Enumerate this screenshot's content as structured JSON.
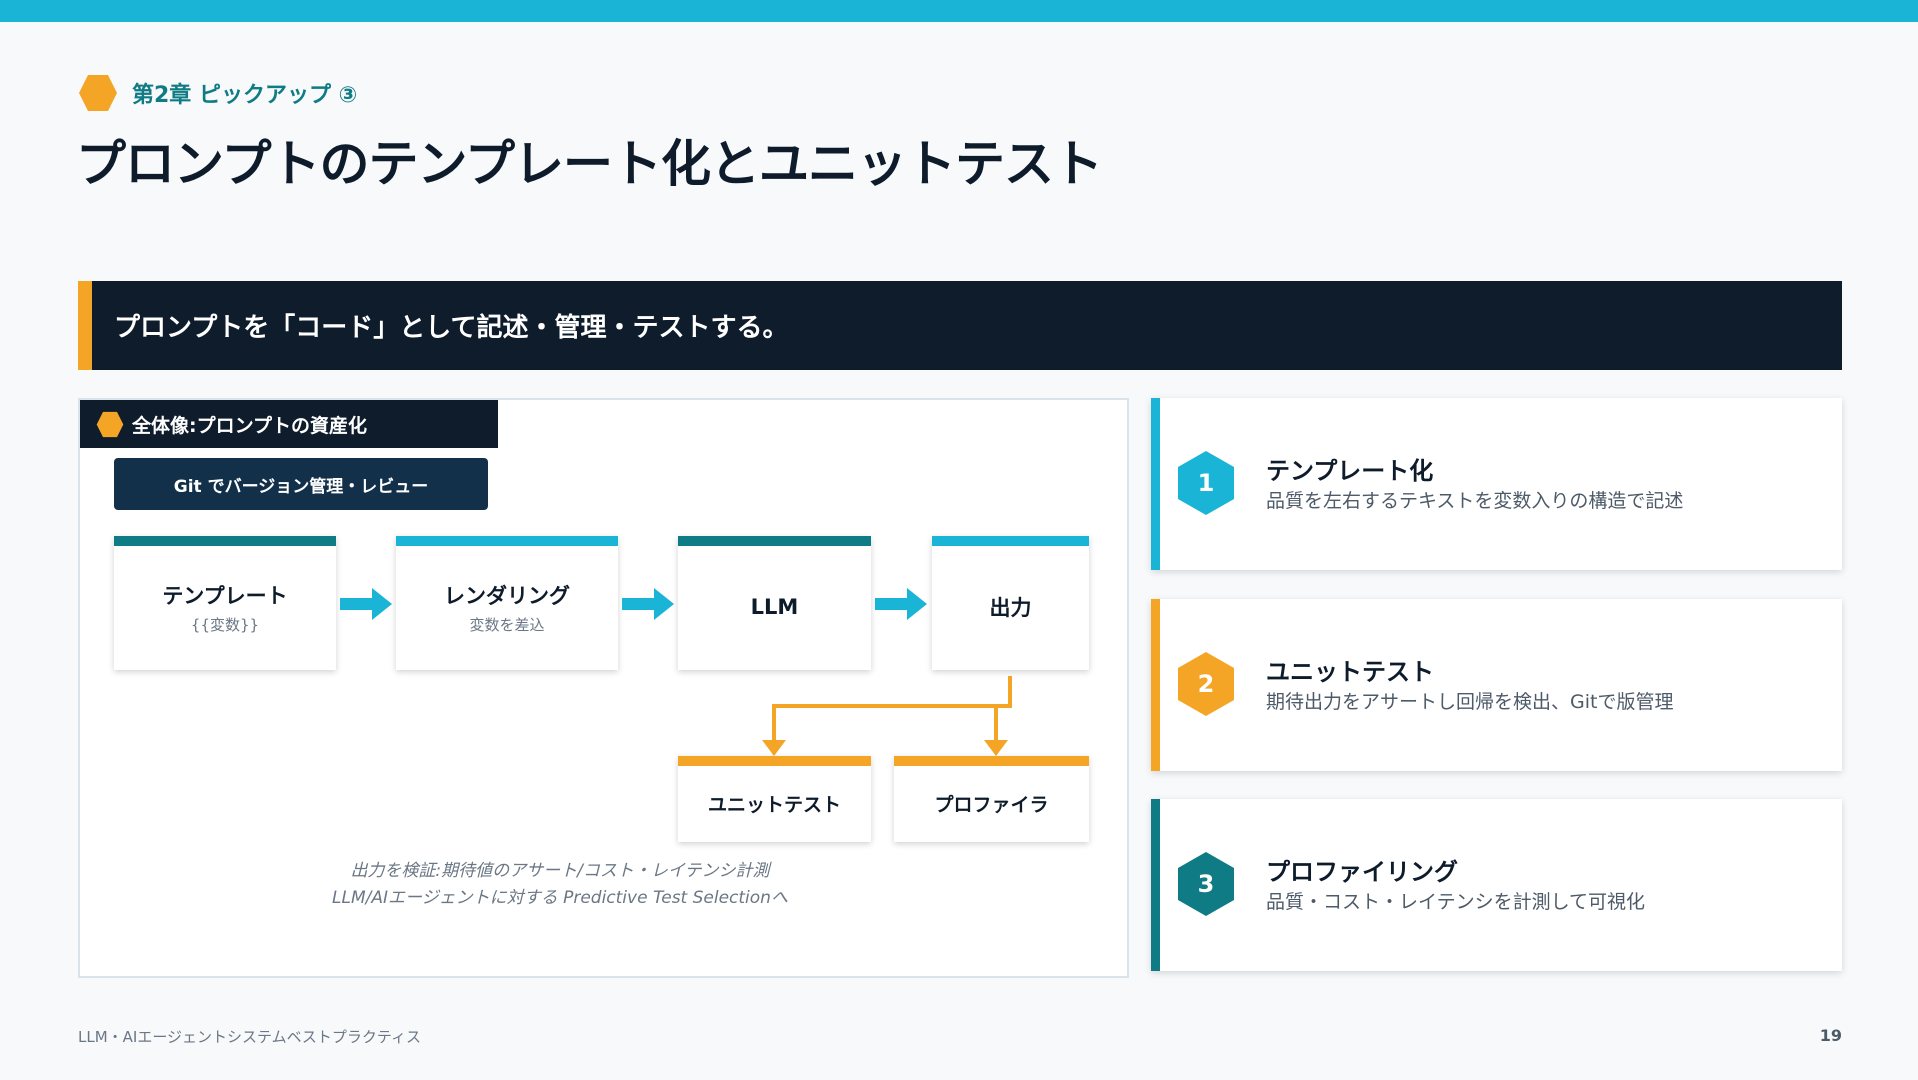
{
  "chapter": {
    "label": "第2章 ピックアップ ③"
  },
  "title": "プロンプトのテンプレート化とユニットテスト",
  "banner": {
    "text": "プロンプトを「コード」として記述・管理・テストする。"
  },
  "diagram": {
    "tab": "全体像:プロンプトの資産化",
    "git": "Git でバージョン管理・レビュー",
    "nodes": {
      "template": {
        "label": "テンプレート",
        "sub": "{{変数}}"
      },
      "rendering": {
        "label": "レンダリング",
        "sub": "変数を差込"
      },
      "llm": {
        "label": "LLM"
      },
      "output": {
        "label": "出力"
      },
      "unittest": {
        "label": "ユニットテスト"
      },
      "profiler": {
        "label": "プロファイラ"
      }
    },
    "caption_line1": "出力を検証:期待値のアサート/コスト・レイテンシ計測",
    "caption_line2": "LLM/AIエージェントに対する Predictive Test Selectionへ"
  },
  "cards": [
    {
      "num": "1",
      "heading": "テンプレート化",
      "desc": "品質を左右するテキストを変数入りの構造で記述",
      "color": "#1ab4d6"
    },
    {
      "num": "2",
      "heading": "ユニットテスト",
      "desc": "期待出力をアサートし回帰を検出、Gitで版管理",
      "color": "#f4a525"
    },
    {
      "num": "3",
      "heading": "プロファイリング",
      "desc": "品質・コスト・レイテンシを計測して可視化",
      "color": "#0f7b84"
    }
  ],
  "colors": {
    "cyan": "#1ab4d6",
    "orange": "#f4a525",
    "teal": "#0f7b84",
    "navy": "#0e1c2b"
  },
  "footer": "LLM・AIエージェントシステムベストプラクティス",
  "page_number": "19"
}
